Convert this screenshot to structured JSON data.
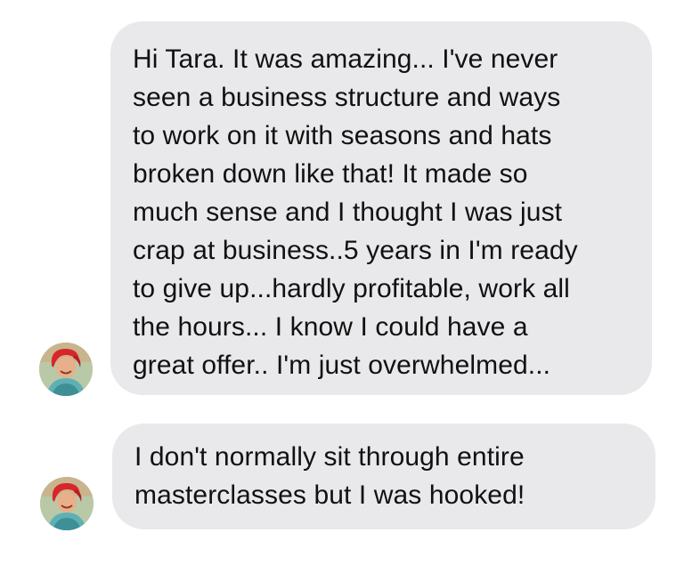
{
  "messages": [
    {
      "lines": [
        "Hi Tara. It was amazing... I've never",
        "seen a business structure and ways",
        "to work on it with seasons and hats",
        "broken down like that! It made so",
        "much sense and I thought I was just",
        "crap at business..5 years in I'm ready",
        "to give up...hardly profitable, work all",
        "the hours... I know I could have a",
        "great offer.. I'm just overwhelmed..."
      ]
    },
    {
      "lines": [
        "I don't normally sit through entire",
        "masterclasses but I was hooked!"
      ]
    }
  ],
  "colors": {
    "bubble": "#e9e9eb",
    "text": "#111111",
    "avatar_hair": "#d8262b",
    "avatar_background": "#b9c9a8",
    "avatar_top": "#5fb0b5"
  },
  "icons": {
    "avatar": "sender-avatar-photo"
  }
}
